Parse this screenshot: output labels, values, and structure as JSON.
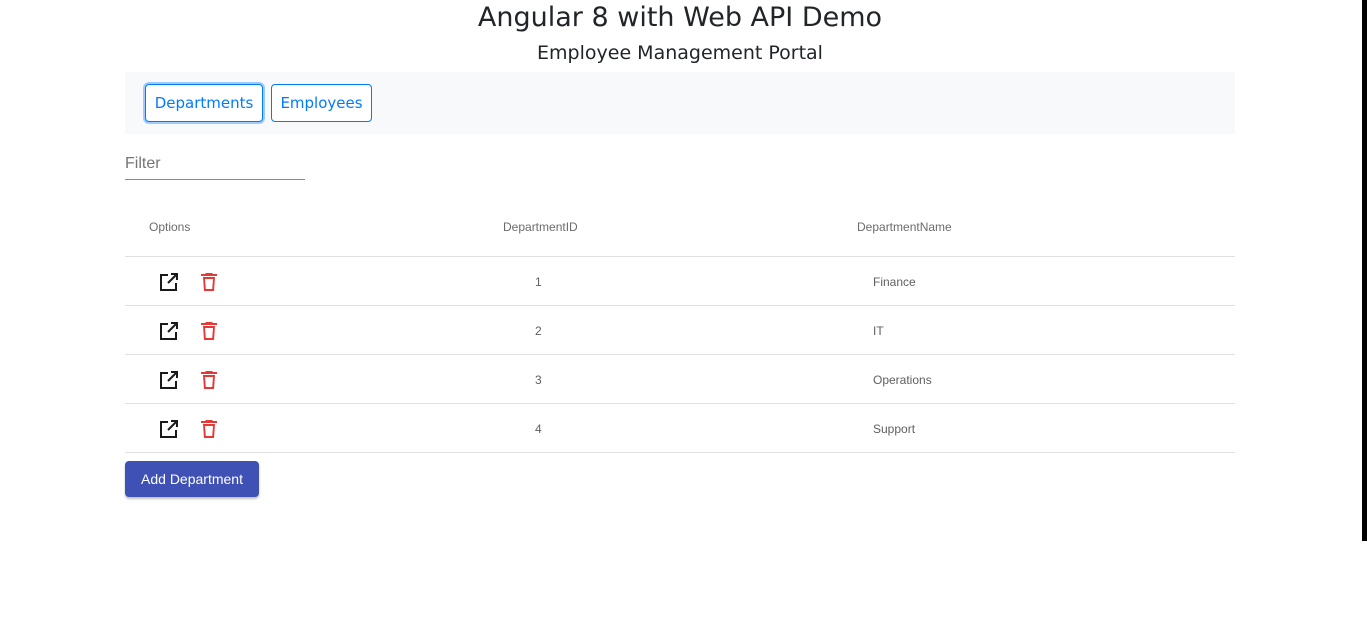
{
  "header": {
    "title": "Angular 8 with Web API Demo",
    "subtitle": "Employee Management Portal"
  },
  "nav": {
    "departments_label": "Departments",
    "employees_label": "Employees",
    "active": "Departments"
  },
  "filter": {
    "placeholder": "Filter",
    "value": ""
  },
  "table": {
    "columns": [
      "Options",
      "DepartmentID",
      "DepartmentName"
    ],
    "rows": [
      {
        "id": "1",
        "name": "Finance"
      },
      {
        "id": "2",
        "name": "IT"
      },
      {
        "id": "3",
        "name": "Operations"
      },
      {
        "id": "4",
        "name": "Support"
      }
    ]
  },
  "actions": {
    "add_label": "Add Department"
  },
  "icons": {
    "edit": "open-in-new-icon",
    "delete": "trash-icon"
  },
  "colors": {
    "primary_button": "#3f51b5",
    "nav_outline": "#007bff",
    "delete_icon": "#e53935",
    "edit_icon": "#1a1a1a"
  }
}
